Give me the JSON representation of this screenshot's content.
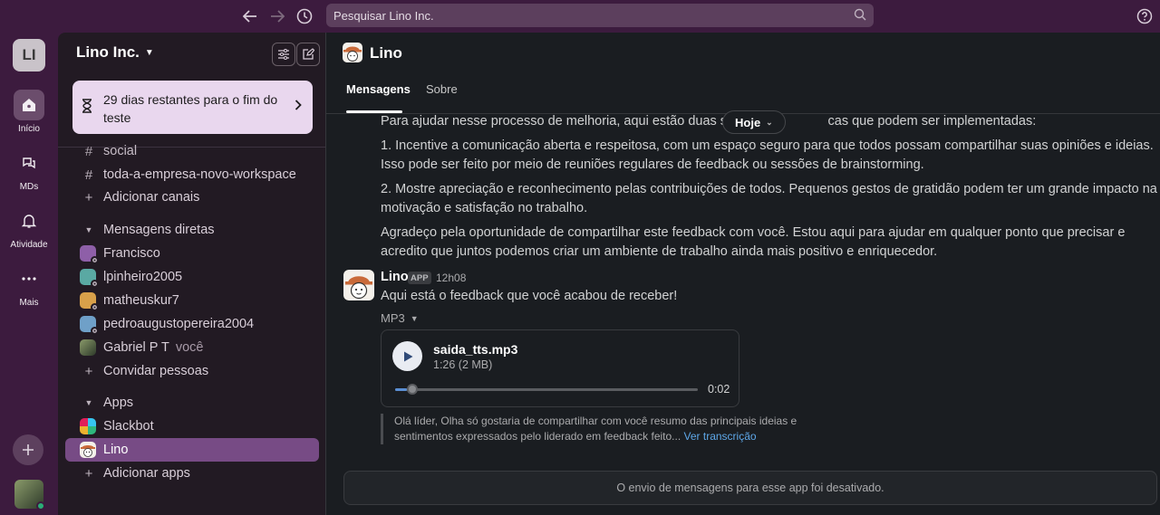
{
  "topbar": {
    "search_placeholder": "Pesquisar Lino Inc."
  },
  "rail": {
    "workspace_initials": "LI",
    "items": [
      {
        "label": "Início",
        "icon": "home-icon"
      },
      {
        "label": "MDs",
        "icon": "dms-icon"
      },
      {
        "label": "Atividade",
        "icon": "bell-icon"
      },
      {
        "label": "Mais",
        "icon": "more-icon"
      }
    ]
  },
  "sidebar": {
    "workspace_name": "Lino Inc.",
    "trial_text": "29 dias restantes para o fim do teste",
    "channels": [
      "social",
      "toda-a-empresa-novo-workspace"
    ],
    "add_channels": "Adicionar canais",
    "dm_section": "Mensagens diretas",
    "dms": [
      {
        "name": "Francisco",
        "color": "#8e5fa8"
      },
      {
        "name": "lpinheiro2005",
        "color": "#5aa9a3"
      },
      {
        "name": "matheuskur7",
        "color": "#d8a04a"
      },
      {
        "name": "pedroaugustopereira2004",
        "color": "#6fa0c8"
      }
    ],
    "self_user": "Gabriel P T",
    "self_suffix": "você",
    "invite": "Convidar pessoas",
    "apps_section": "Apps",
    "apps": [
      "Slackbot",
      "Lino"
    ],
    "add_apps": "Adicionar apps"
  },
  "channel": {
    "title": "Lino",
    "tabs": [
      "Mensagens",
      "Sobre"
    ],
    "date_pill": "Hoje"
  },
  "messages": {
    "paragraphs": [
      "Para ajudar nesse processo de melhoria, aqui estão duas suges",
      "cas que podem ser implementadas:",
      "1. Incentive a comunicação aberta e respeitosa, com um espaço seguro para que todos possam compartilhar suas opiniões e ideias. Isso pode ser feito por meio de reuniões regulares de feedback ou sessões de brainstorming.",
      "2. Mostre apreciação e reconhecimento pelas contribuições de todos. Pequenos gestos de gratidão podem ter um grande impacto na motivação e satisfação no trabalho.",
      "Agradeço pela oportunidade de compartilhar este feedback com você. Estou aqui para ajudar em qualquer ponto que precisar e acredito que juntos podemos criar um ambiente de trabalho ainda mais positivo e enriquecedor."
    ],
    "author": "Lino",
    "badge": "APP",
    "time": "12h08",
    "body": "Aqui está o feedback que você acabou de receber!",
    "file_type": "MP3",
    "file_name": "saida_tts.mp3",
    "file_size": "1:26 (2 MB)",
    "duration": "0:02",
    "progress": 0.04,
    "transcript": "Olá líder, Olha só gostaria de compartilhar com você resumo das principais ideias e sentimentos expressados pelo liderado em feedback feito...",
    "transcript_link": "Ver transcrição"
  },
  "composer": {
    "disabled_text": "O envio de mensagens para esse app foi desativado."
  }
}
